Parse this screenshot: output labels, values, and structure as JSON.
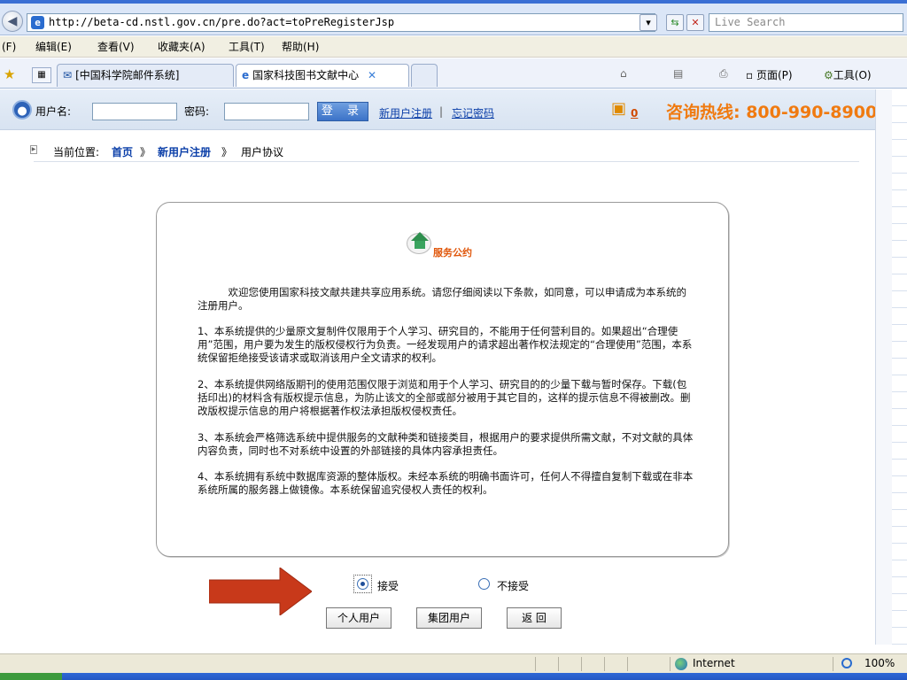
{
  "browser": {
    "url": "http://beta-cd.nstl.gov.cn/pre.do?act=toPreRegisterJsp",
    "search_placeholder": "Live Search",
    "menu": [
      "(F)",
      "编辑(E)",
      "查看(V)",
      "收藏夹(A)",
      "工具(T)",
      "帮助(H)"
    ],
    "tabs": [
      {
        "label": "[中国科学院邮件系统]"
      },
      {
        "label": "国家科技图书文献中心"
      }
    ],
    "commands": {
      "page": "页面(P)",
      "tools": "工具(O)"
    },
    "status": {
      "zone": "Internet",
      "zoom": "100%"
    }
  },
  "header": {
    "username_label": "用户名:",
    "password_label": "密码:",
    "login_button": "登 录",
    "register_link": "新用户注册",
    "separator": "|",
    "forgot_link": "忘记密码",
    "cart_count": "0",
    "hotline": "咨询热线: 800-990-8900"
  },
  "breadcrumb": {
    "prefix": "当前位置:",
    "home": "首页",
    "sep": "》",
    "register": "新用户注册",
    "current": "用户协议"
  },
  "agreement": {
    "title": "服务公约",
    "paragraphs": [
      "　　　欢迎您使用国家科技文献共建共享应用系统。请您仔细阅读以下条款，如同意，可以申请成为本系统的注册用户。",
      "1、本系统提供的少量原文复制件仅限用于个人学习、研究目的，不能用于任何营利目的。如果超出“合理使用”范围，用户要为发生的版权侵权行为负责。一经发现用户的请求超出著作权法规定的“合理使用”范围，本系统保留拒绝接受该请求或取消该用户全文请求的权利。",
      "2、本系统提供网络版期刊的使用范围仅限于浏览和用于个人学习、研究目的的少量下载与暂时保存。下载(包括印出)的材料含有版权提示信息，为防止该文的全部或部分被用于其它目的，这样的提示信息不得被删改。删改版权提示信息的用户将根据著作权法承担版权侵权责任。",
      "3、本系统会严格筛选系统中提供服务的文献种类和链接类目，根据用户的要求提供所需文献，不对文献的具体内容负责，同时也不对系统中设置的外部链接的具体内容承担责任。",
      "4、本系统拥有系统中数据库资源的整体版权。未经本系统的明确书面许可，任何人不得擅自复制下载或在非本系统所属的服务器上做镜像。本系统保留追究侵权人责任的权利。"
    ]
  },
  "form": {
    "accept_label": "接受",
    "reject_label": "不接受",
    "selected": "accept",
    "buttons": {
      "personal": "个人用户",
      "group": "集团用户",
      "back": "返 回"
    }
  },
  "colors": {
    "hotline": "#f07a10",
    "link": "#0a3ea8",
    "arrow": "#c8391a",
    "title": "#e0560a"
  }
}
